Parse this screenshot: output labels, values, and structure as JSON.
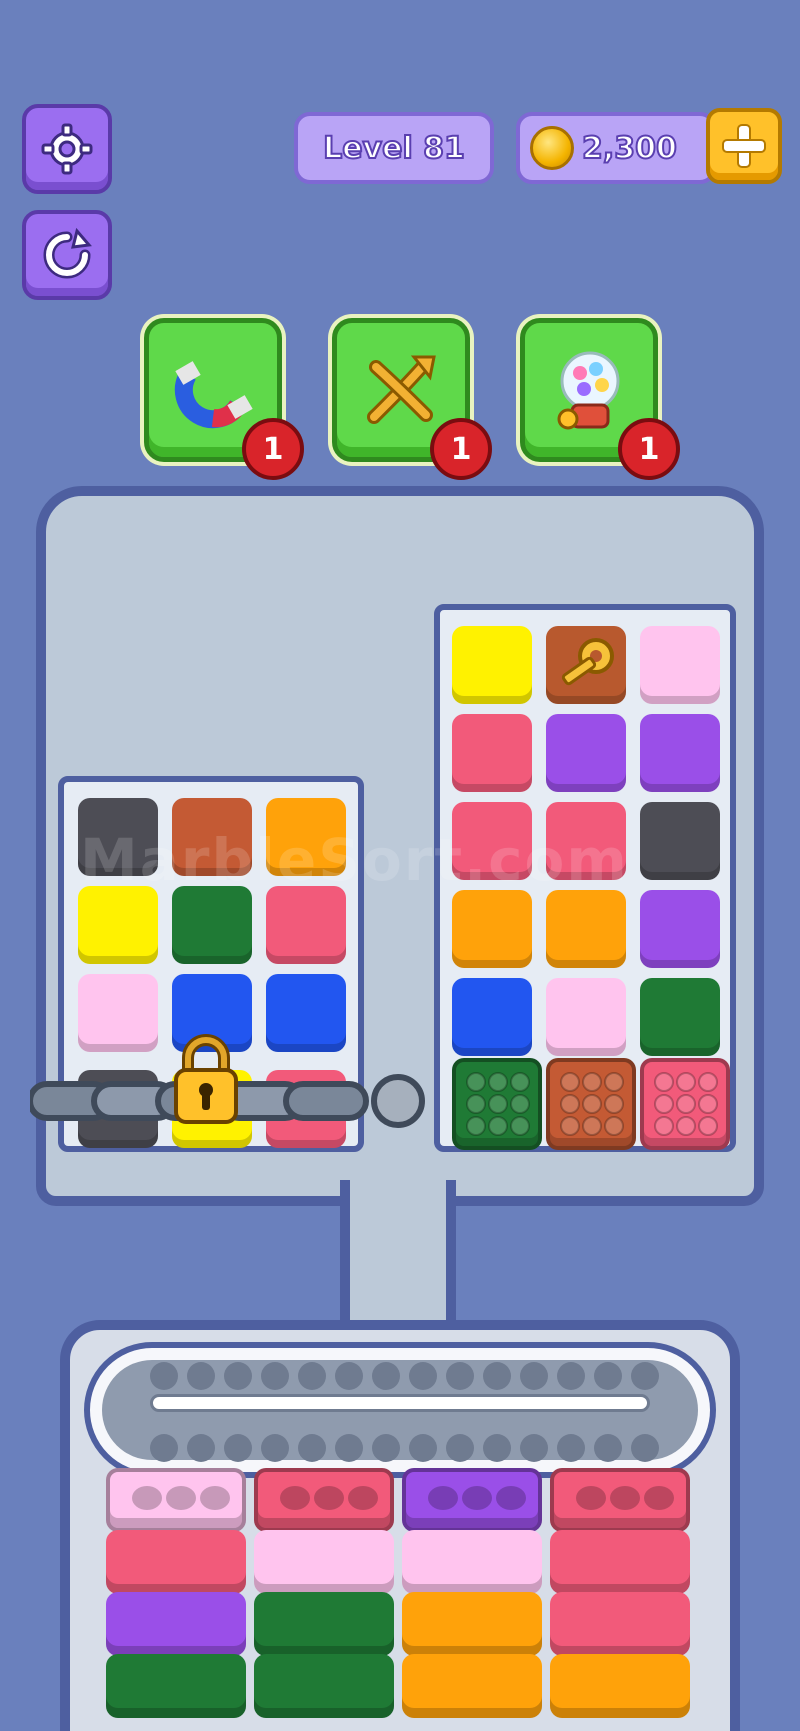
{
  "hud": {
    "level_label": "Level 81",
    "coins": "2,300"
  },
  "boosters": [
    {
      "name": "magnet",
      "count": "1"
    },
    {
      "name": "shuffle",
      "count": "1"
    },
    {
      "name": "gumball",
      "count": "1"
    }
  ],
  "watermark": "MarbleSort.com",
  "colors": {
    "background": "#6a80bd",
    "pink": "#ffc4ee",
    "red": "#f25a7a",
    "purple": "#9a4fe8",
    "orange": "#ffa20a",
    "yellow": "#fff200",
    "green": "#1f7a35",
    "blue": "#2256f0",
    "brown": "#c45a34",
    "gray": "#4d4d55"
  },
  "left_grid": [
    [
      "gray",
      "brown",
      "orange"
    ],
    [
      "yellow",
      "green",
      "red"
    ],
    [
      "pink",
      "blue",
      "blue"
    ]
  ],
  "right_grid": [
    [
      "yellow",
      "key",
      "pink"
    ],
    [
      "red",
      "purple",
      "purple"
    ],
    [
      "red",
      "red",
      "gray"
    ],
    [
      "orange",
      "orange",
      "purple"
    ],
    [
      "blue",
      "pink",
      "green"
    ]
  ],
  "marble_boxes": [
    "green",
    "brown",
    "red"
  ],
  "stacks": [
    [
      "pink",
      "red",
      "purple",
      "green"
    ],
    [
      "red",
      "pink",
      "green",
      "green"
    ],
    [
      "purple",
      "pink",
      "orange",
      "orange"
    ],
    [
      "red",
      "red",
      "red",
      "orange"
    ]
  ]
}
